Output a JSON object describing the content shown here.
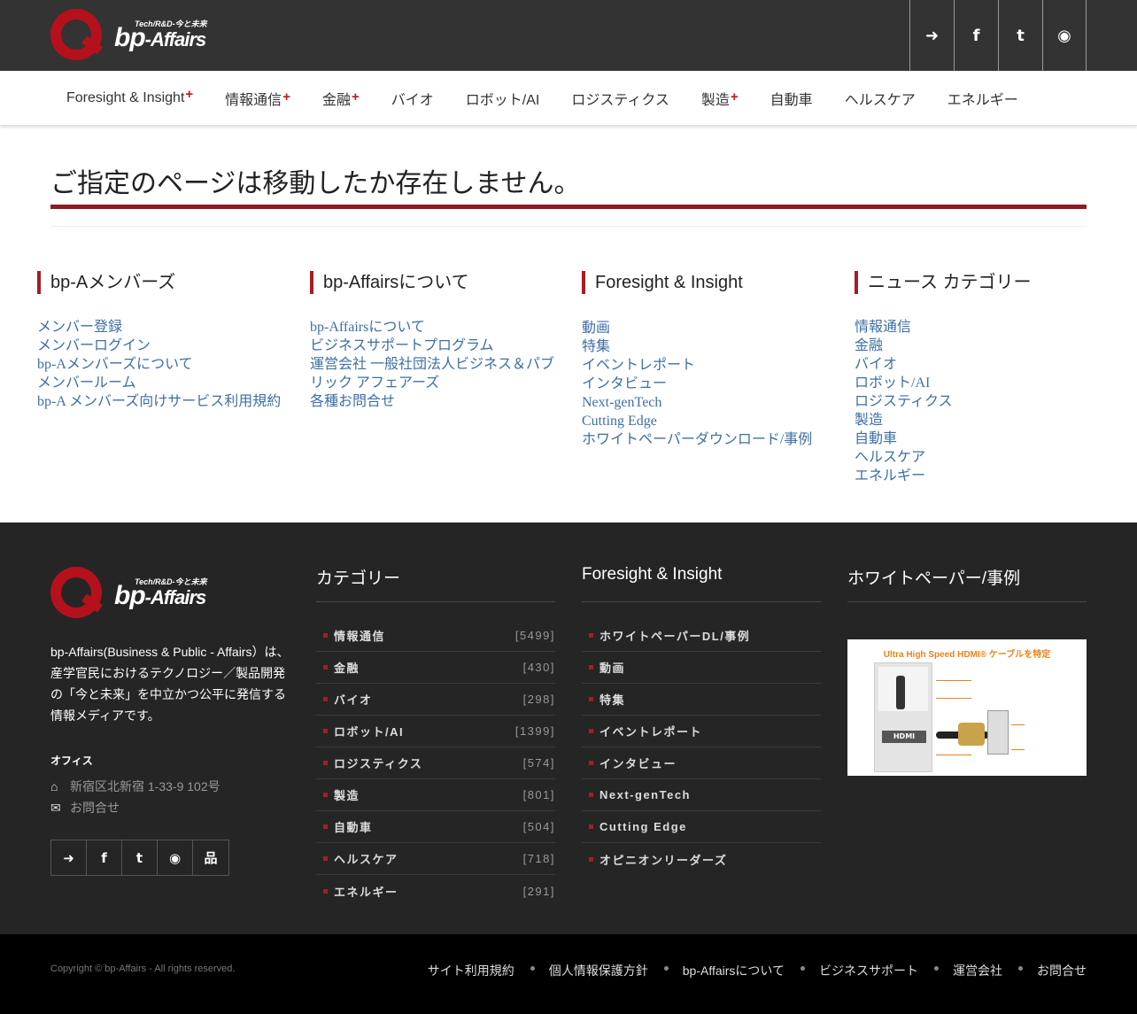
{
  "brand": {
    "tagline": "Tech/R&D-今と未来",
    "wordmark_main": "bp",
    "wordmark_rest": "-Affairs"
  },
  "header_social": [
    {
      "icon": "sign-in-icon",
      "glyph": "➜"
    },
    {
      "icon": "facebook-icon",
      "glyph": "f"
    },
    {
      "icon": "twitter-icon",
      "glyph": "t"
    },
    {
      "icon": "rss-icon",
      "glyph": "◉"
    }
  ],
  "nav": {
    "items": [
      {
        "label": "Foresight & Insight",
        "has_sub": true
      },
      {
        "label": "情報通信",
        "has_sub": true
      },
      {
        "label": "金融",
        "has_sub": true
      },
      {
        "label": "バイオ",
        "has_sub": false
      },
      {
        "label": "ロボット/AI",
        "has_sub": false
      },
      {
        "label": "ロジスティクス",
        "has_sub": false
      },
      {
        "label": "製造",
        "has_sub": true
      },
      {
        "label": "自動車",
        "has_sub": false
      },
      {
        "label": "ヘルスケア",
        "has_sub": false
      },
      {
        "label": "エネルギー",
        "has_sub": false
      }
    ],
    "plus_glyph": "+"
  },
  "page": {
    "title": "ご指定のページは移動したか存在しません。"
  },
  "sitemap": [
    {
      "heading": "bp-Aメンバーズ",
      "links": [
        "メンバー登録",
        "メンバーログイン",
        "bp-Aメンバーズについて",
        "メンバールーム",
        "bp-A メンバーズ向けサービス利用規約"
      ]
    },
    {
      "heading": "bp-Affairsについて",
      "links": [
        "bp-Affairsについて",
        "ビジネスサポートプログラム",
        "運営会社 一般社団法人ビジネス＆パブリック アフェアーズ",
        "各種お問合せ"
      ]
    },
    {
      "heading": "Foresight & Insight",
      "links": [
        "動画",
        "特集",
        "イベントレポート",
        "インタビュー",
        "Next-genTech",
        "Cutting Edge",
        "ホワイトペーパーダウンロード/事例"
      ]
    },
    {
      "heading": "ニュース カテゴリー",
      "links": [
        "情報通信",
        "金融",
        "バイオ",
        "ロボット/AI",
        "ロジスティクス",
        "製造",
        "自動車",
        "ヘルスケア",
        "エネルギー"
      ]
    }
  ],
  "footer": {
    "about": "bp-Affairs(Business & Public - Affairs）は、産学官民におけるテクノロジー／製品開発の「今と未来」を中立かつ公平に発信する情報メディアです。",
    "office_heading": "オフィス",
    "address": "新宿区北新宿 1-33-9 102号",
    "contact": "お問合せ",
    "home_glyph": "⌂",
    "mail_glyph": "✉",
    "social": [
      {
        "icon": "sign-in-icon",
        "glyph": "➜"
      },
      {
        "icon": "facebook-icon",
        "glyph": "f"
      },
      {
        "icon": "twitter-icon",
        "glyph": "t"
      },
      {
        "icon": "rss-icon",
        "glyph": "◉"
      },
      {
        "icon": "sitemap-icon",
        "glyph": "品"
      }
    ],
    "categories_heading": "カテゴリー",
    "categories": [
      {
        "label": "情報通信",
        "count": "[5499]"
      },
      {
        "label": "金融",
        "count": "[430]"
      },
      {
        "label": "バイオ",
        "count": "[298]"
      },
      {
        "label": "ロボット/AI",
        "count": "[1399]"
      },
      {
        "label": "ロジスティクス",
        "count": "[574]"
      },
      {
        "label": "製造",
        "count": "[801]"
      },
      {
        "label": "自動車",
        "count": "[504]"
      },
      {
        "label": "ヘルスケア",
        "count": "[718]"
      },
      {
        "label": "エネルギー",
        "count": "[291]"
      }
    ],
    "fi_heading": "Foresight & Insight",
    "fi_links": [
      "ホワイトペーパーDL/事例",
      "動画",
      "特集",
      "イベントレポート",
      "インタビュー",
      "Next-genTech",
      "Cutting Edge",
      "オピニオンリーダーズ"
    ],
    "wp_heading": "ホワイトペーパー/事例",
    "wp_image_title": "Ultra High Speed HDMI® ケーブルを特定",
    "wp_pkg_logo": "HDMI"
  },
  "bottom": {
    "copyright": "Copyright © bp-Affairs - All rights reserved.",
    "links": [
      "サイト利用規約",
      "個人情報保護方針",
      "bp-Affairsについて",
      "ビジネスサポート",
      "運営会社",
      "お問合せ"
    ]
  },
  "colors": {
    "accent": "#a51d26",
    "header_bg": "#333333",
    "footer_bg": "#252525",
    "link": "#3d6fa6"
  }
}
